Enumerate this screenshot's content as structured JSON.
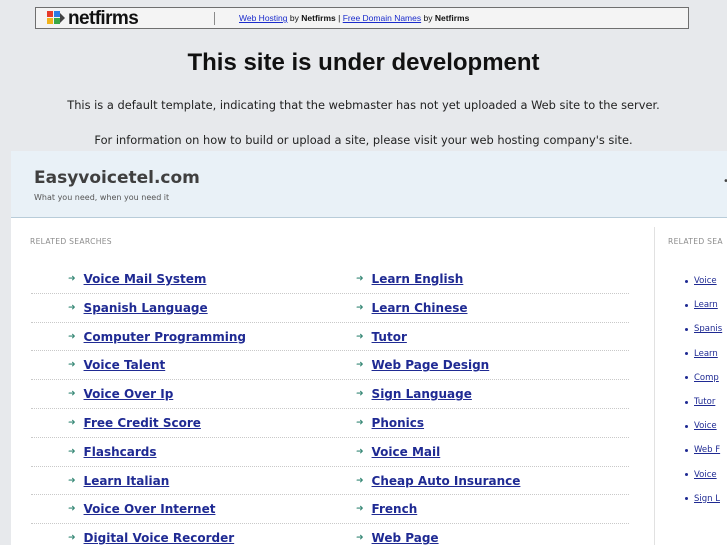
{
  "banner": {
    "logo_text": "netfirms",
    "link1": "Web Hosting",
    "by1": "by",
    "brand1": "Netfirms",
    "separator": "|",
    "link2": "Free Domain Names",
    "by2": "by",
    "brand2": "Netfirms"
  },
  "headline": "This site is under development",
  "info_line_1": "This is a default template, indicating that the webmaster has not yet uploaded a Web site to the server.",
  "info_line_2": "For information on how to build or upload a site, please visit your web hosting company's site.",
  "site": {
    "title": "Easyvoicetel.com",
    "tagline": "What you need, when you need it"
  },
  "related_label": "RELATED SEARCHES",
  "related_label_right": "RELATED SEA",
  "left_column": [
    "Voice Mail System",
    "Spanish Language",
    "Computer Programming",
    "Voice Talent",
    "Voice Over Ip",
    "Free Credit Score",
    "Flashcards",
    "Learn Italian",
    "Voice Over Internet",
    "Digital Voice Recorder"
  ],
  "right_column": [
    "Learn English",
    "Learn Chinese",
    "Tutor",
    "Web Page Design",
    "Sign Language",
    "Phonics",
    "Voice Mail",
    "Cheap Auto Insurance",
    "French",
    "Web Page"
  ],
  "side_links": [
    "Voice",
    "Learn",
    "Spanis",
    "Learn",
    "Comp",
    "Tutor",
    "Voice",
    "Web F",
    "Voice",
    "Sign L"
  ],
  "colors": {
    "link": "#1f2a93",
    "arrow": "#3a8a78",
    "header_bg": "#e9f1f7"
  }
}
